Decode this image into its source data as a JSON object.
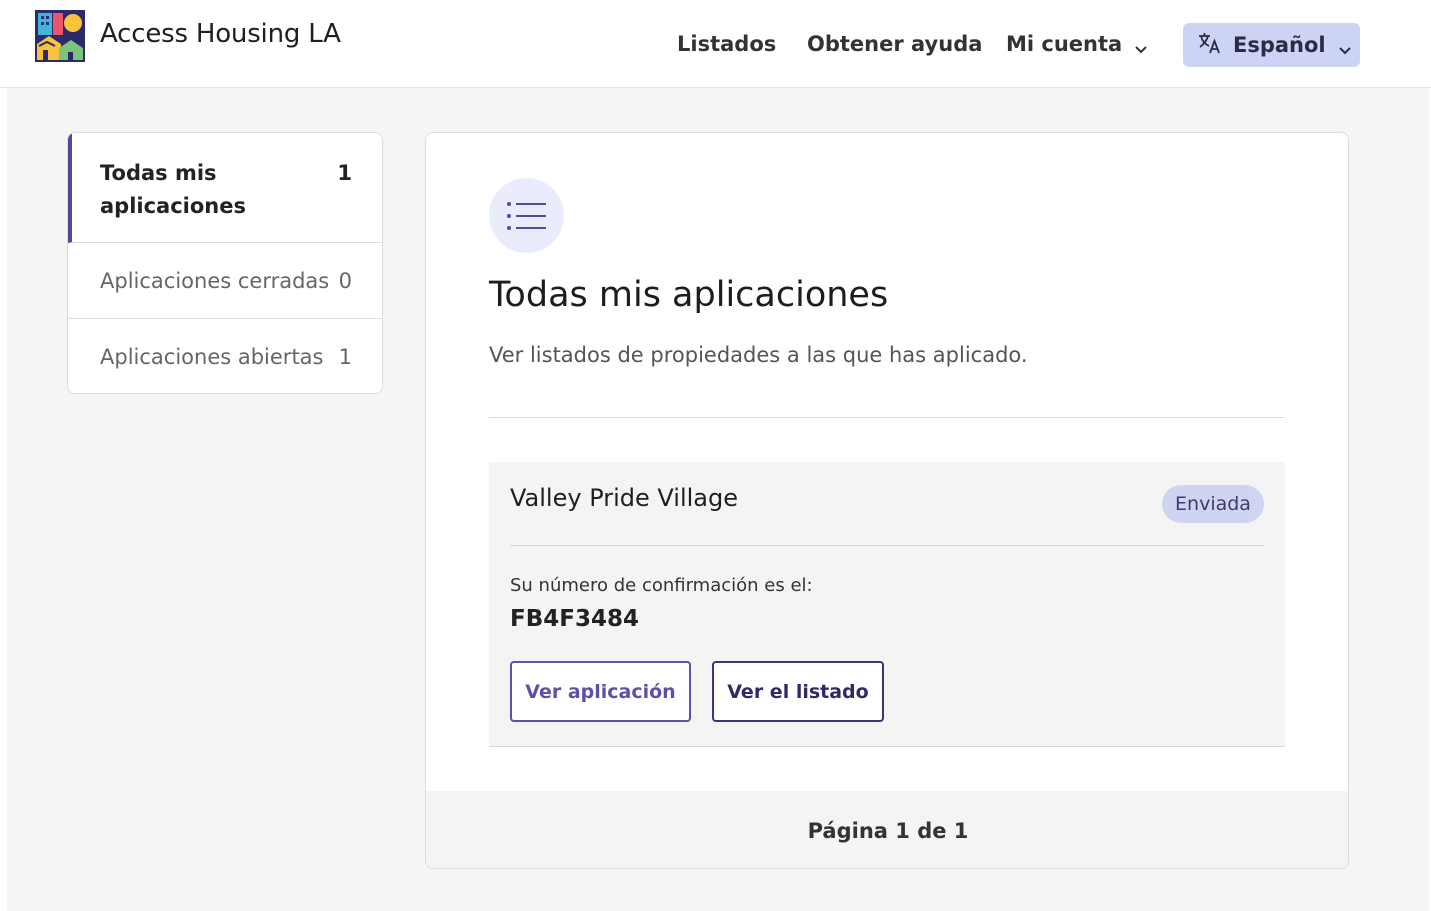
{
  "header": {
    "site_title": "Access Housing LA",
    "logo_icon": "access-housing-la-logo",
    "nav": {
      "listados": "Listados",
      "ayuda": "Obtener ayuda",
      "cuenta": "Mi cuenta"
    },
    "language": "Español"
  },
  "sidebar": {
    "items": [
      {
        "label": "Todas mis aplicaciones",
        "count": "1",
        "active": true
      },
      {
        "label": "Aplicaciones cerradas",
        "count": "0",
        "active": false
      },
      {
        "label": "Aplicaciones abiertas",
        "count": "1",
        "active": false
      }
    ]
  },
  "main": {
    "icon": "list-icon",
    "title": "Todas mis aplicaciones",
    "subtitle": "Ver listados de propiedades a las que has aplicado.",
    "applications": [
      {
        "name": "Valley Pride Village",
        "status": "Enviada",
        "confirm_label": "Su número de confirmación es el:",
        "confirm_number": "FB4F3484",
        "view_app_label": "Ver aplicación",
        "view_listing_label": "Ver el listado"
      }
    ],
    "pagination": "Página 1 de 1"
  },
  "colors": {
    "accent": "#5b52a8",
    "accent_dark": "#3b3477",
    "language_bg": "#cdd3f5",
    "badge_bg": "#cfd4f3",
    "page_bg": "#f5f5f5"
  }
}
